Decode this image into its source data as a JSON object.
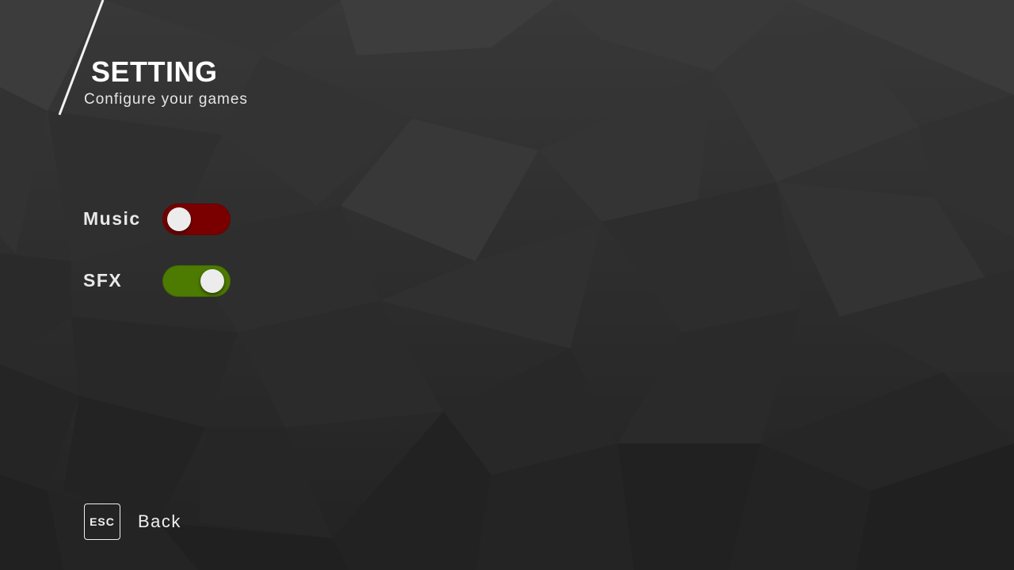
{
  "header": {
    "title": "SETTING",
    "subtitle": "Configure your games"
  },
  "settings": [
    {
      "label": "Music",
      "enabled": false,
      "color": "#7a0000"
    },
    {
      "label": "SFX",
      "enabled": true,
      "color": "#4d7a00"
    }
  ],
  "footer": {
    "key_label": "ESC",
    "back_label": "Back"
  },
  "colors": {
    "toggle_off": "#7a0000",
    "toggle_on": "#4d7a00",
    "knob": "#ececec",
    "text": "#ffffff"
  }
}
